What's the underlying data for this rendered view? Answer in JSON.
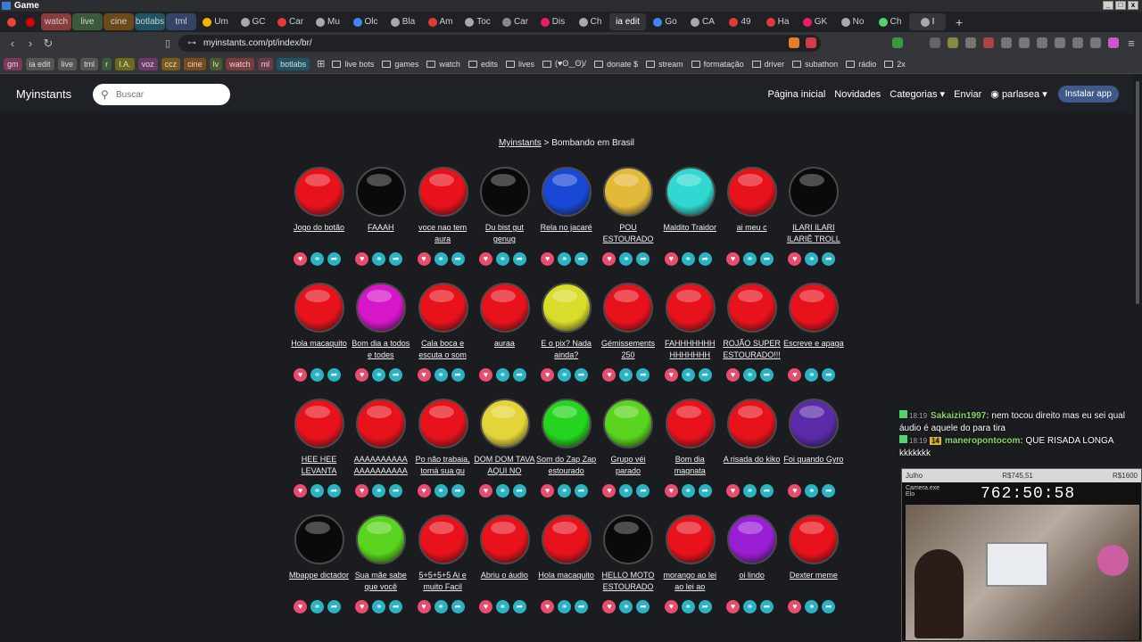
{
  "os": {
    "title": "Game"
  },
  "tabs": [
    {
      "label": "",
      "color": "#ea4335"
    },
    {
      "label": "",
      "color": "#d00"
    },
    {
      "label": "watch",
      "bg": "#8a3b3b",
      "color": ""
    },
    {
      "label": "live",
      "bg": "#3a5a3a",
      "color": ""
    },
    {
      "label": "cine",
      "bg": "#6a4a1a",
      "color": ""
    },
    {
      "label": "botlabs",
      "bg": "#1f5560",
      "color": ""
    },
    {
      "label": "tml",
      "bg": "#334466",
      "color": ""
    },
    {
      "label": "Um",
      "color": "#f4b400"
    },
    {
      "label": "GC",
      "color": "#aaa"
    },
    {
      "label": "Car",
      "color": "#e53935"
    },
    {
      "label": "Mu",
      "color": "#aaa"
    },
    {
      "label": "Olc",
      "color": "#4285f4"
    },
    {
      "label": "Bla",
      "color": "#aaa"
    },
    {
      "label": "Am",
      "color": "#e53935"
    },
    {
      "label": "Toc",
      "color": "#aaa"
    },
    {
      "label": "Car",
      "color": "#888"
    },
    {
      "label": "Dis",
      "color": "#e91e63"
    },
    {
      "label": "Ch",
      "color": "#aaa"
    },
    {
      "label": "ia edit",
      "active": true,
      "color": ""
    },
    {
      "label": "Go",
      "color": "#4285f4"
    },
    {
      "label": "CA",
      "color": "#aaa"
    },
    {
      "label": "49",
      "color": "#e53935"
    },
    {
      "label": "Ha",
      "color": "#e53935"
    },
    {
      "label": "GK",
      "color": "#e91e63"
    },
    {
      "label": "No",
      "color": "#aaa"
    },
    {
      "label": "Ch",
      "color": "#53d36b"
    },
    {
      "label": "I",
      "color": "#aaa",
      "active": true
    }
  ],
  "address": {
    "url": "myinstants.com/pt/index/br/"
  },
  "bookmarks": [
    {
      "label": "gm",
      "bg": "#7a3b5a"
    },
    {
      "label": "ia edit",
      "bg": "#555"
    },
    {
      "label": "live",
      "bg": "#555"
    },
    {
      "label": "tml",
      "bg": "#555"
    },
    {
      "label": "r",
      "bg": "#3a5a3a"
    },
    {
      "label": "I.A.",
      "bg": "#6a6a1a"
    },
    {
      "label": "voz",
      "bg": "#6a3a6a"
    },
    {
      "label": "ccz",
      "bg": "#7a5a1a"
    },
    {
      "label": "cine",
      "bg": "#7a4a1a"
    },
    {
      "label": "lv",
      "bg": "#4a5a2a"
    },
    {
      "label": "watch",
      "bg": "#7a3b3b"
    },
    {
      "label": "ml",
      "bg": "#6a3a4a"
    },
    {
      "label": "botlabs",
      "bg": "#1f5560"
    }
  ],
  "bookmark_folders": [
    "live bots",
    "games",
    "watch",
    "edits",
    "lives",
    "(♥ʘ‿ʘ)/",
    "donate $",
    "stream",
    "formatação",
    "driver",
    "subathon",
    "rádio",
    "2x"
  ],
  "site": {
    "logo": "Myinstants",
    "search_placeholder": "Buscar",
    "nav": {
      "home": "Página inicial",
      "news": "Novidades",
      "categories": "Categorias",
      "send": "Enviar",
      "user": "parlasea",
      "install": "Instalar app"
    },
    "breadcrumb": {
      "home": "Myinstants",
      "sep": " > ",
      "current": "Bombando em Brasil"
    }
  },
  "buttons": [
    {
      "label": "Jogo do botão",
      "color": "#e8121c"
    },
    {
      "label": "FAAAH",
      "color": "#0a0a0a"
    },
    {
      "label": "voce nao tem aura",
      "color": "#e8121c"
    },
    {
      "label": "Du bist gut genug",
      "color": "#0a0a0a"
    },
    {
      "label": "Rela no jacaré",
      "color": "#1a48d6"
    },
    {
      "label": "POU ESTOURADO",
      "color": "#e3b93a"
    },
    {
      "label": "Maldito Traidor",
      "color": "#2fd8d0"
    },
    {
      "label": "ai meu c",
      "color": "#e8121c"
    },
    {
      "label": "ILARI ILARI ILARIÊ TROLL",
      "color": "#0a0a0a"
    },
    {
      "label": "Hola macaquito",
      "color": "#e8121c"
    },
    {
      "label": "Bom dia a todos e todes",
      "color": "#d616c8"
    },
    {
      "label": "Cala boca e escuta o som",
      "color": "#e8121c"
    },
    {
      "label": "auraa",
      "color": "#e8121c"
    },
    {
      "label": "E o pix? Nada ainda?",
      "color": "#d8dc2a"
    },
    {
      "label": "Gémissements 250",
      "color": "#e8121c"
    },
    {
      "label": "FAHHHHHHH HHHHHHH",
      "color": "#e8121c"
    },
    {
      "label": "ROJÃO SUPER ESTOURADO!!!",
      "color": "#e8121c"
    },
    {
      "label": "Escreve e apaga",
      "color": "#e8121c"
    },
    {
      "label": "HEE HEE LEVANTA",
      "color": "#e8121c"
    },
    {
      "label": "AAAAAAAAAA AAAAAAAAAA",
      "color": "#e8121c"
    },
    {
      "label": "Po não trabaia, tomá sua gu",
      "color": "#e8121c"
    },
    {
      "label": "DOM DOM TAVA AQUI NO",
      "color": "#e3d43a"
    },
    {
      "label": "Som do Zap Zap estourado",
      "color": "#24d41e"
    },
    {
      "label": "Grupo véi parado",
      "color": "#5ad41e"
    },
    {
      "label": "Bom dia magnata",
      "color": "#e8121c"
    },
    {
      "label": "A risada do kiko",
      "color": "#e8121c"
    },
    {
      "label": "Foi quando Gyro",
      "color": "#5a2aa8"
    },
    {
      "label": "Mbappe dictador",
      "color": "#0a0a0a"
    },
    {
      "label": "Sua mãe sabe que você",
      "color": "#5ad41e"
    },
    {
      "label": "5+5+5+5 Ai e muito Facil",
      "color": "#e8121c"
    },
    {
      "label": "Abriu o áudio",
      "color": "#e8121c"
    },
    {
      "label": "Hola macaquito",
      "color": "#e8121c"
    },
    {
      "label": "HELLO MOTO ESTOURADO",
      "color": "#0a0a0a"
    },
    {
      "label": "morango ao lei ao lei ao",
      "color": "#e8121c"
    },
    {
      "label": "oi lindo",
      "color": "#9a1ed4"
    },
    {
      "label": "Dexter meme",
      "color": "#e8121c"
    }
  ],
  "chat": [
    {
      "time": "18:19",
      "user": "Sakaizin1997:",
      "msg": " nem tocou direito mas eu sei qual áudio é aquele do para tira"
    },
    {
      "time": "18:19",
      "badge": "14",
      "user": "maneropontocom:",
      "msg": " QUE RISADA LONGA kkkkkkk"
    }
  ],
  "overlay": {
    "label": "Julho",
    "left_value": "R$745,51",
    "right_value": "R$1600",
    "timer": "762:50:58",
    "window_title": "Camera.exe",
    "window_sub": "Elo"
  }
}
